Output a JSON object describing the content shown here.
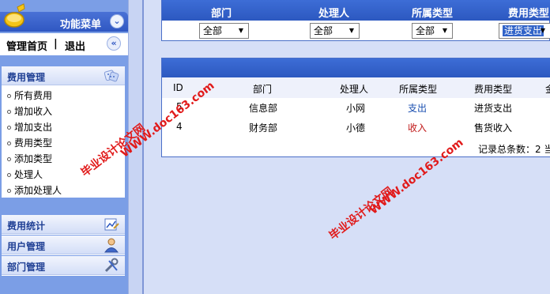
{
  "sidebar": {
    "menu_title": "功能菜单",
    "menu_toggle": "⌄",
    "quick": {
      "home": "管理首页",
      "sep": "|",
      "exit": "退出",
      "collapse": "«"
    },
    "expense_group": {
      "title": "费用管理",
      "items": [
        "所有费用",
        "增加收入",
        "增加支出",
        "费用类型",
        "添加类型",
        "处理人",
        "添加处理人"
      ]
    },
    "stats_group": {
      "title": "费用统计"
    },
    "users_group": {
      "title": "用户管理"
    },
    "depts_group": {
      "title": "部门管理"
    }
  },
  "filter": {
    "headers": [
      "部门",
      "处理人",
      "所属类型",
      "费用类型"
    ],
    "dept_value": "全部",
    "handler_value": "全部",
    "category_value": "全部",
    "expense_type_value": "进货支出"
  },
  "results": {
    "columns": [
      "ID",
      "部门",
      "处理人",
      "所属类型",
      "费用类型",
      "金"
    ],
    "rows": [
      {
        "id": "5",
        "dept": "信息部",
        "handler": "小网",
        "category": "支出",
        "type": "进货支出"
      },
      {
        "id": "4",
        "dept": "财务部",
        "handler": "小德",
        "category": "收入",
        "type": "售货收入"
      }
    ],
    "total_line": "记录总条数：2 当"
  },
  "watermarks": {
    "url": "WWW.doc163.com",
    "text": "毕业设计论文网"
  },
  "colors": {
    "header_blue": "#2c58c0",
    "income_red": "#c01818",
    "expense_blue": "#1a4fb0",
    "watermark": "#e11a1a"
  }
}
